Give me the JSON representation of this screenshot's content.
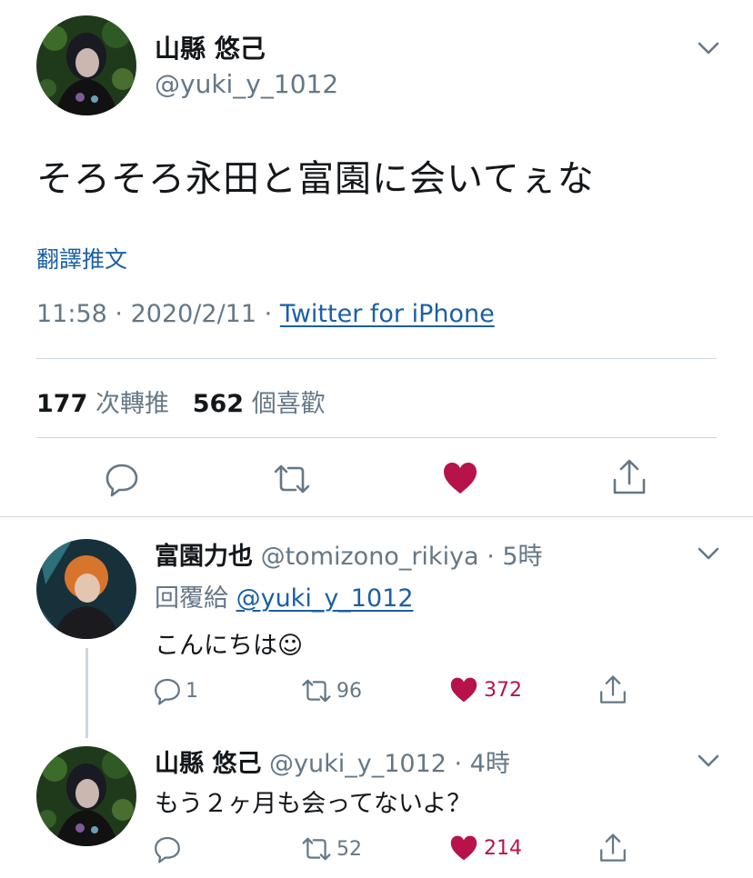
{
  "main_tweet": {
    "author_name": "山縣 悠己",
    "author_handle": "@yuki_y_1012",
    "text": "そろそろ永田と富園に会いてぇな",
    "translate_label": "翻譯推文",
    "time": "11:58",
    "date": "2020/2/11",
    "separator": "·",
    "source": "Twitter for iPhone",
    "retweet_count": "177",
    "retweet_label": "次轉推",
    "like_count": "562",
    "like_label": "個喜歡"
  },
  "replies": [
    {
      "author_name": "富園力也",
      "author_handle": "@tomizono_rikiya",
      "time_ago": "· 5時",
      "reply_to_label": "回覆給",
      "reply_to_handle": "@yuki_y_1012",
      "text": "こんにちは☺",
      "reply_count": "1",
      "retweet_count": "96",
      "like_count": "372"
    },
    {
      "author_name": "山縣 悠己",
      "author_handle": "@yuki_y_1012",
      "time_ago": "· 4時",
      "text": "もう２ヶ月も会ってないよ？",
      "retweet_count": "52",
      "like_count": "214"
    }
  ],
  "icons": {
    "more": "chevron-down-icon",
    "reply": "reply-icon",
    "retweet": "retweet-icon",
    "like": "heart-icon",
    "share": "share-icon"
  },
  "colors": {
    "link": "#1b5fa6",
    "like": "#b7134a",
    "secondary_text": "#657786",
    "divider": "#ccd6dd"
  }
}
